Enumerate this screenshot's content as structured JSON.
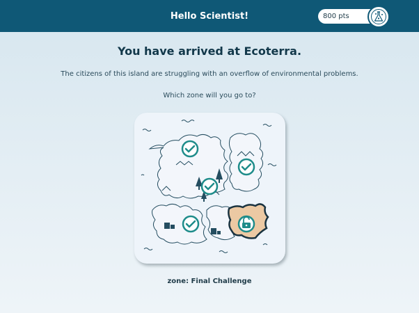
{
  "header": {
    "greeting": "Hello Scientist!",
    "points": "800 pts",
    "avatar_icon": "science-flask-icon"
  },
  "main": {
    "title": "You have arrived at Ecoterra.",
    "subtitle": "The citizens of this island are struggling with an overflow of environmental problems.",
    "question": "Which zone will you go to?"
  },
  "map": {
    "zones": [
      {
        "id": "north-west",
        "status": "completed",
        "icon": "checkmark-icon"
      },
      {
        "id": "east",
        "status": "completed",
        "icon": "checkmark-icon"
      },
      {
        "id": "forest",
        "status": "completed",
        "icon": "checkmark-icon"
      },
      {
        "id": "south-west",
        "status": "completed",
        "icon": "checkmark-icon"
      },
      {
        "id": "final-challenge",
        "status": "locked",
        "icon": "unlocked-padlock-icon"
      }
    ]
  },
  "selection": {
    "zone_label": "zone: Final Challenge"
  },
  "colors": {
    "header": "#0f5876",
    "accent": "#1e8c8a",
    "highlight_zone": "#ecc9a3"
  }
}
